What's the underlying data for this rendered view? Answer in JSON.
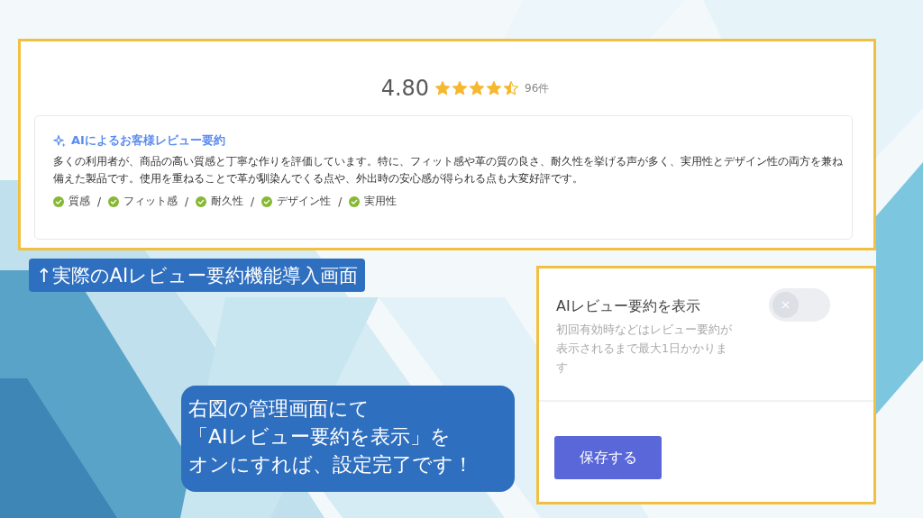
{
  "review_panel": {
    "rating": "4.80",
    "stars": 4.5,
    "count": "96件",
    "summary": {
      "title": "AIによるお客様レビュー要約",
      "text": "多くの利用者が、商品の高い質感と丁寧な作りを評価しています。特に、フィット感や革の質の良さ、耐久性を挙げる声が多く、実用性とデザイン性の両方を兼ね備えた製品です。使用を重ねることで革が馴染んでくる点や、外出時の安心感が得られる点も大変好評です。",
      "tags": [
        {
          "label": "質感",
          "separator": "/"
        },
        {
          "label": "フィット感",
          "separator": "/"
        },
        {
          "label": "耐久性",
          "separator": "/"
        },
        {
          "label": "デザイン性",
          "separator": "/"
        },
        {
          "label": "実用性"
        }
      ]
    }
  },
  "caption": "↑実際のAIレビュー要約機能導入画面",
  "settings_panel": {
    "label": "AIレビュー要約を表示",
    "description": "初回有効時などはレビュー要約が表示されるまで最大1日かかります",
    "on": false,
    "save_button": "保存する"
  },
  "callout": {
    "lines": [
      "右図の管理画面にて",
      "「AIレビュー要約を表示」を",
      "オンにすれば、設定完了です！"
    ]
  }
}
